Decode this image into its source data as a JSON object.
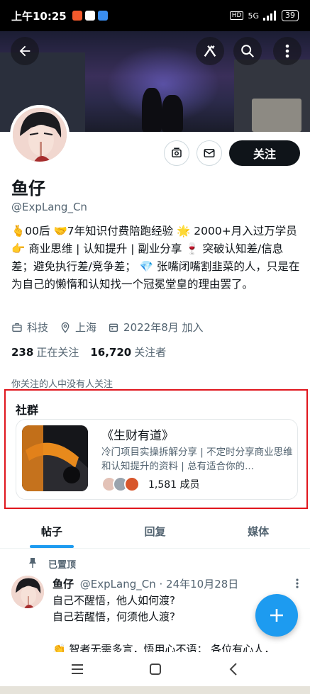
{
  "status_bar": {
    "time": "上午10:25",
    "network": "5G",
    "battery": "39"
  },
  "header": {
    "back_icon": "arrow-left-icon",
    "grok_icon": "grok-icon",
    "search_icon": "search-icon",
    "more_icon": "more-vertical-icon"
  },
  "profile": {
    "name": "鱼仔",
    "handle": "@ExpLang_Cn",
    "bio": "🫰00后 🤝7年知识付费陪跑经验 🌟 2000+月入过万学员 👉 商业思维 | 认知提升 | 副业分享 🍷 突破认知差/信息差；避免执行差/竞争差； 💎 张嘴闭嘴割韭菜的人，只是在为自己的懒惰和认知找一个冠冕堂皇的理由罢了。",
    "category": "科技",
    "location": "上海",
    "joined": "2022年8月 加入",
    "following_count": "238",
    "following_label": "正在关注",
    "followers_count": "16,720",
    "followers_label": "关注者",
    "mutuals_text": "你关注的人中没有人关注",
    "follow_button": "关注"
  },
  "community": {
    "section_title": "社群",
    "name": "《生财有道》",
    "description": "冷门项目实操拆解分享 | 不定时分享商业思维和认知提升的资料 | 总有适合你的...",
    "members": "1,581 成员"
  },
  "tabs": [
    {
      "label": "帖子",
      "active": true
    },
    {
      "label": "回复",
      "active": false
    },
    {
      "label": "媒体",
      "active": false
    }
  ],
  "pinned_post": {
    "pinned_label": "已置顶",
    "author": "鱼仔",
    "handle_date": "@ExpLang_Cn · 24年10月28日",
    "body": "自己不醒悟，他人如何渡?\n自己若醒悟，何须他人渡?\n\n👏 智者无需多言，悟用心不语； 各位有心人，"
  },
  "colors": {
    "accent": "#1d9bf0",
    "highlight_border": "#e0161d",
    "follow_button_bg": "#0f1419",
    "muted_text": "#536471"
  }
}
